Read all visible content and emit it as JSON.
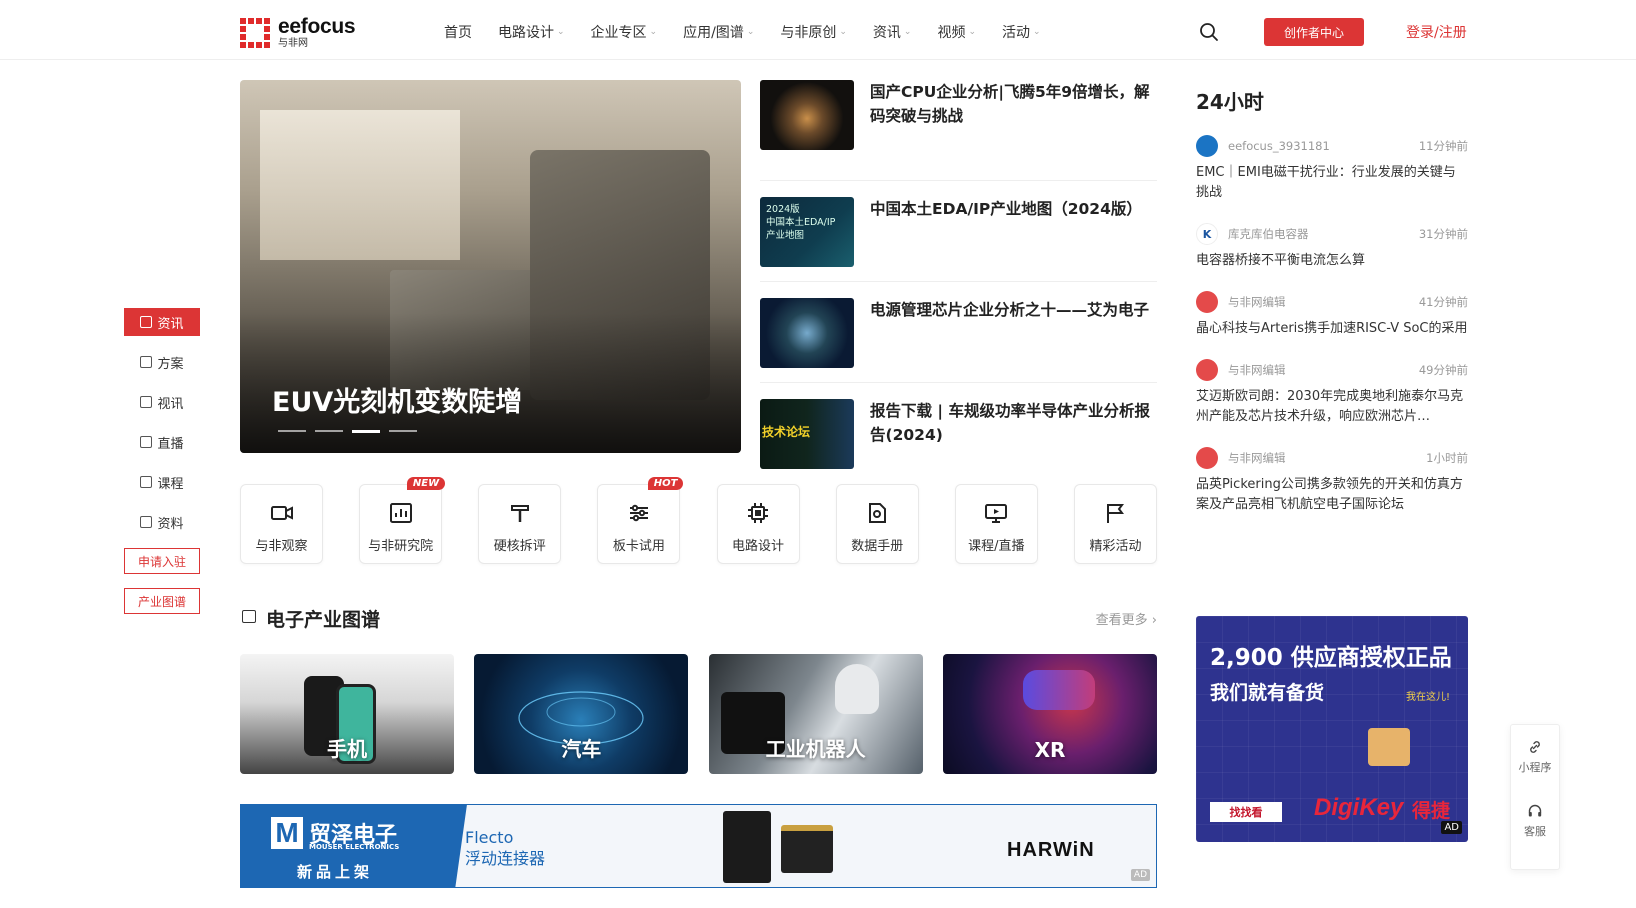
{
  "header": {
    "logo_en": "eefocus",
    "logo_cn": "与非网",
    "nav": [
      {
        "label": "首页",
        "has_menu": false
      },
      {
        "label": "电路设计",
        "has_menu": true
      },
      {
        "label": "企业专区",
        "has_menu": true
      },
      {
        "label": "应用/图谱",
        "has_menu": true
      },
      {
        "label": "与非原创",
        "has_menu": true
      },
      {
        "label": "资讯",
        "has_menu": true
      },
      {
        "label": "视频",
        "has_menu": true
      },
      {
        "label": "活动",
        "has_menu": true
      }
    ],
    "chevron": "⌄",
    "creator_btn": "创作者中心",
    "login": "登录/注册"
  },
  "sidenav": {
    "items": [
      "资讯",
      "方案",
      "视讯",
      "直播",
      "课程",
      "资料"
    ],
    "active_index": 0,
    "buttons": [
      "申请入驻",
      "产业图谱"
    ]
  },
  "hero": {
    "title": "EUV光刻机变数陡增",
    "slides": 4,
    "active_slide": 2
  },
  "news": [
    {
      "title": "国产CPU企业分析|飞腾5年9倍增长，解码突破与挑战",
      "thumb_text": ""
    },
    {
      "title": "中国本土EDA/IP产业地图（2024版）",
      "thumb_text": "2024版\n中国本土EDA/IP\n产业地图"
    },
    {
      "title": "电源管理芯片企业分析之十——艾为电子",
      "thumb_text": ""
    },
    {
      "title": "报告下载 | 车规级功率半导体产业分析报告(2024)",
      "thumb_text": "技术论坛"
    }
  ],
  "categories": [
    {
      "label": "与非观察",
      "badge": "",
      "icon": "video-icon"
    },
    {
      "label": "与非研究院",
      "badge": "NEW",
      "icon": "chart-icon"
    },
    {
      "label": "硬核拆评",
      "badge": "",
      "icon": "hammer-icon"
    },
    {
      "label": "板卡试用",
      "badge": "HOT",
      "icon": "sliders-icon"
    },
    {
      "label": "电路设计",
      "badge": "",
      "icon": "chip-icon"
    },
    {
      "label": "数据手册",
      "badge": "",
      "icon": "document-icon"
    },
    {
      "label": "课程/直播",
      "badge": "",
      "icon": "monitor-icon"
    },
    {
      "label": "精彩活动",
      "badge": "",
      "icon": "flag-icon"
    }
  ],
  "industry": {
    "title": "电子产业图谱",
    "more": "查看更多 ›",
    "cards": [
      "手机",
      "汽车",
      "工业机器人",
      "XR"
    ]
  },
  "ad_banner": {
    "mouser_mark": "M",
    "mouser_brand": "贸泽电子",
    "mouser_sub": "MOUSER ELECTRONICS",
    "mouser_tag": "新品上架",
    "product_en": "Flecto",
    "product_cn": "浮动连接器",
    "partner": "HARWiN",
    "ad_label": "AD"
  },
  "h24": {
    "title": "24小时",
    "items": [
      {
        "author": "eefocus_3931181",
        "time": "11分钟前",
        "text": "EMC｜EMI电磁干扰行业：行业发展的关键与挑战",
        "avatar": "blue"
      },
      {
        "author": "库克库伯电容器",
        "time": "31分钟前",
        "text": "电容器桥接不平衡电流怎么算",
        "avatar": "k"
      },
      {
        "author": "与非网编辑",
        "time": "41分钟前",
        "text": "晶心科技与Arteris携手加速RISC-V SoC的采用",
        "avatar": "red"
      },
      {
        "author": "与非网编辑",
        "time": "49分钟前",
        "text": "艾迈斯欧司朗：2030年完成奥地利施泰尔马克州产能及芯片技术升级，响应欧洲芯片…",
        "avatar": "red"
      },
      {
        "author": "与非网编辑",
        "time": "1小时前",
        "text": "品英Pickering公司携多款领先的开关和仿真方案及产品亮相飞机航空电子国际论坛",
        "avatar": "red"
      }
    ]
  },
  "ad_right": {
    "line1": "2,900 供应商授权正品",
    "line2": "我们就有备货",
    "here": "我在这儿!",
    "find": "找找看",
    "brand": "DigiKey",
    "brand_cn": "得捷",
    "ad_label": "AD"
  },
  "float": {
    "items": [
      {
        "label": "小程序",
        "icon": "link-icon"
      },
      {
        "label": "客服",
        "icon": "headset-icon"
      }
    ]
  }
}
